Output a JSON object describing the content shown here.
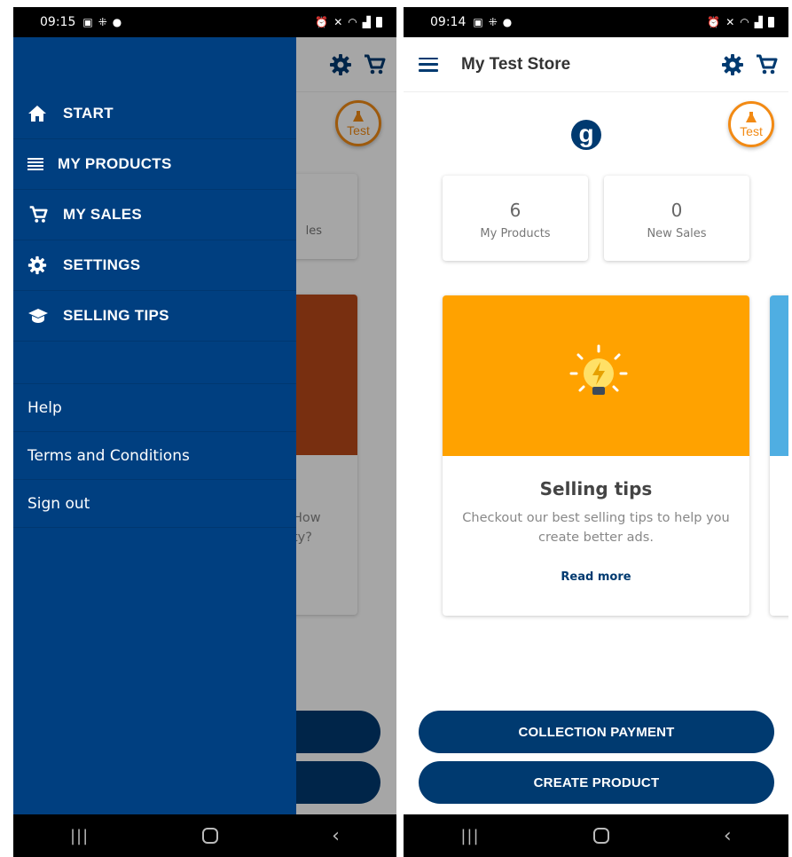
{
  "left_screen": {
    "status_bar": {
      "time": "09:15"
    },
    "drawer": {
      "items": [
        {
          "label": "START",
          "icon": "home-icon"
        },
        {
          "label": "MY PRODUCTS",
          "icon": "list-icon"
        },
        {
          "label": "MY SALES",
          "icon": "cart-icon"
        },
        {
          "label": "SETTINGS",
          "icon": "gear-icon"
        },
        {
          "label": "SELLING TIPS",
          "icon": "graduation-cap-icon"
        }
      ],
      "links": [
        "Help",
        "Terms and Conditions",
        "Sign out"
      ]
    },
    "background": {
      "stat_fragment": "les",
      "tip_title_fragment": "s",
      "tip_desc_fragment_1": "How",
      "tip_desc_fragment_2": "ty?"
    }
  },
  "right_screen": {
    "status_bar": {
      "time": "09:14"
    },
    "app_bar": {
      "title": "My Test Store"
    },
    "badge": {
      "label": "Test"
    },
    "logo": {
      "letter": "g"
    },
    "stats": [
      {
        "value": "6",
        "label": "My Products"
      },
      {
        "value": "0",
        "label": "New Sales"
      }
    ],
    "tip_card": {
      "title": "Selling tips",
      "description": "Checkout our best selling tips to help you create better ads.",
      "link": "Read more"
    },
    "buttons": {
      "collection_payment": "COLLECTION PAYMENT",
      "create_product": "CREATE PRODUCT"
    }
  },
  "colors": {
    "primary": "#003a70",
    "drawer": "#003f80",
    "accent_orange": "#f28a14",
    "tip_image": "#ffa200"
  }
}
